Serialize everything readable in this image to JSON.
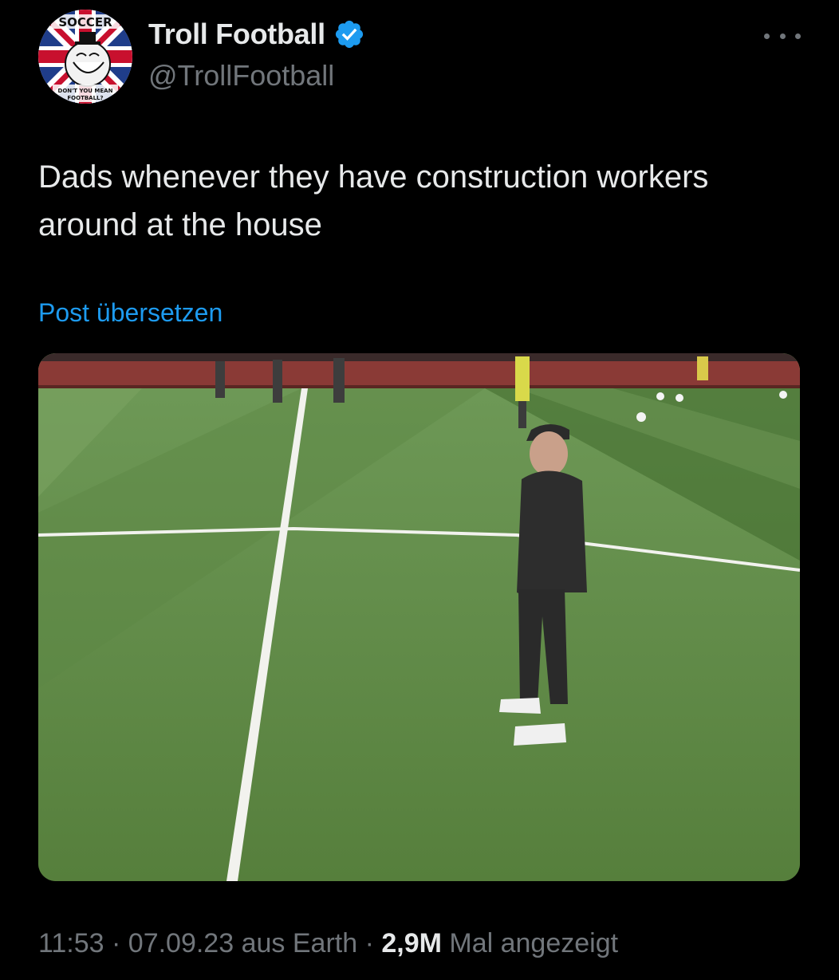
{
  "author": {
    "display_name": "Troll Football",
    "handle": "@TrollFootball",
    "verified": true,
    "avatar_texts": {
      "top": "SOCCER",
      "bottom": "DON'T YOU MEAN FOOTBALL?"
    }
  },
  "tweet": {
    "text": "Dads whenever they have construction workers around at the house",
    "translate_label": "Post übersetzen"
  },
  "meta": {
    "time": "11:53",
    "sep1": " · ",
    "date": "07.09.23",
    "source": " aus Earth",
    "sep2": " · ",
    "views_count": "2,9M",
    "views_label": " Mal angezeigt"
  },
  "icons": {
    "verified": "verified-badge-icon",
    "more": "more-options-icon"
  },
  "colors": {
    "background": "#000000",
    "text_primary": "#e7e9ea",
    "text_secondary": "#71767b",
    "link": "#1d9bf0",
    "verified": "#1d9bf0"
  }
}
